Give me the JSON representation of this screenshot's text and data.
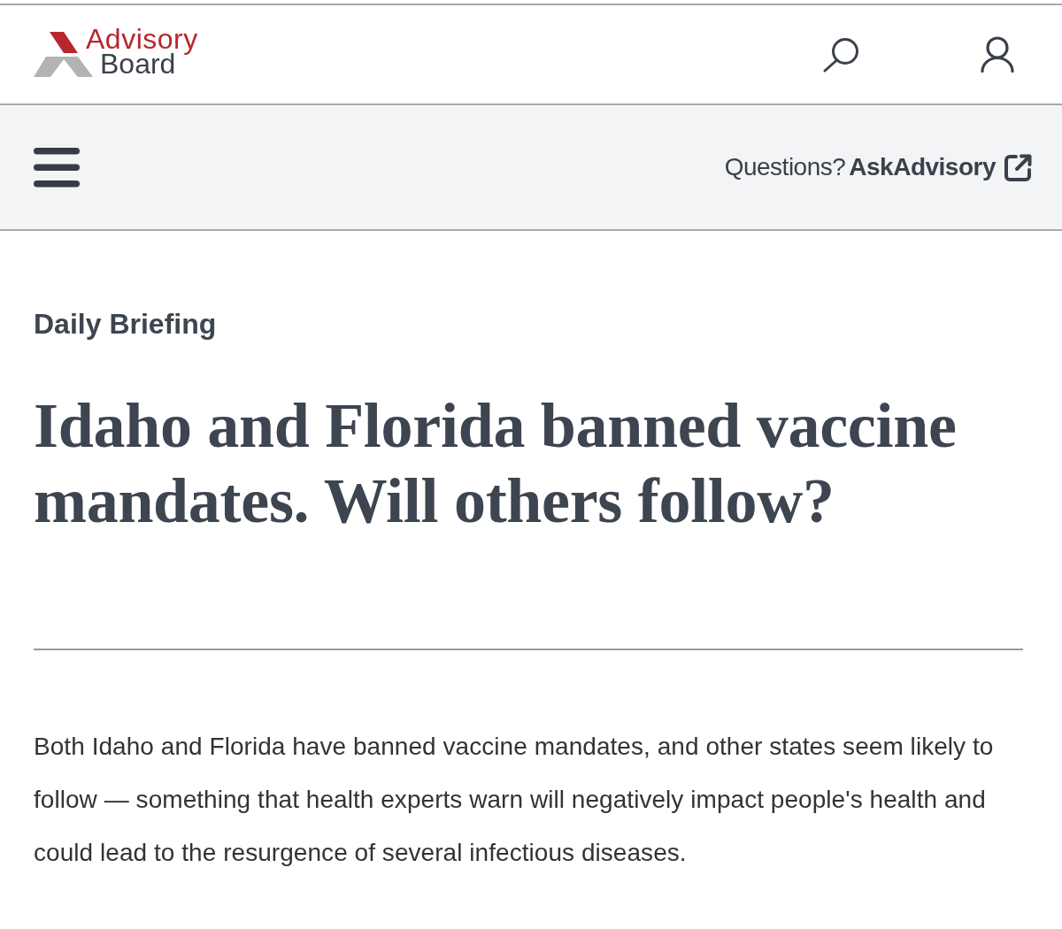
{
  "header": {
    "logo": {
      "line_1": "Advisory",
      "line_2": "Board"
    }
  },
  "subnav": {
    "question": "Questions?",
    "link": "AskAdvisory"
  },
  "article": {
    "section": "Daily Briefing",
    "title": "Idaho and Florida banned vaccine mandates. Will others follow?",
    "summary": "Both Idaho and Florida have banned vaccine mandates, and other states seem likely to follow — something that health experts warn will negatively impact people's health and could lead to the resurgence of several infectious diseases."
  }
}
